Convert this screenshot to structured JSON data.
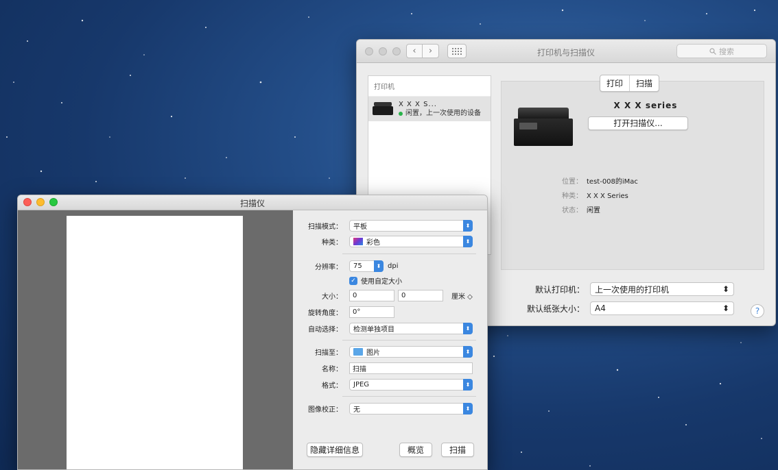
{
  "prefs": {
    "title": "打印机与扫描仪",
    "search_placeholder": "搜索",
    "list_header": "打印机",
    "printer_item": {
      "name": "X X X  S...",
      "status": "闲置，上一次使用的设备"
    },
    "tabs": [
      "打印",
      "扫描"
    ],
    "printer_title": "X X X  series",
    "open_scanner": "打开扫描仪...",
    "info": [
      {
        "key": "位置：",
        "value": "test-008的iMac"
      },
      {
        "key": "种类：",
        "value": "X X X  Series"
      },
      {
        "key": "状态：",
        "value": "闲置"
      }
    ],
    "default_printer_label": "默认打印机：",
    "default_printer_value": "上一次使用的打印机",
    "default_paper_label": "默认纸张大小：",
    "default_paper_value": "A4",
    "help": "?"
  },
  "scanner": {
    "title": "扫描仪",
    "scan_mode_label": "扫描模式：",
    "scan_mode_value": "平板",
    "kind_label": "种类：",
    "kind_value": "彩色",
    "resolution_label": "分辨率：",
    "resolution_value": "75",
    "resolution_unit": "dpi",
    "custom_size_label": "使用自定大小",
    "size_label": "大小：",
    "size_w": "0",
    "size_h": "0",
    "size_unit": "厘米 ◇",
    "rotation_label": "旋转角度：",
    "rotation_value": "0°",
    "auto_select_label": "自动选择：",
    "auto_select_value": "检测单独项目",
    "scan_to_label": "扫描至：",
    "scan_to_value": "图片",
    "name_label": "名称：",
    "name_value": "扫描",
    "format_label": "格式：",
    "format_value": "JPEG",
    "correction_label": "图像校正：",
    "correction_value": "无",
    "hide_details": "隐藏详细信息",
    "overview": "概览",
    "scan": "扫描"
  }
}
